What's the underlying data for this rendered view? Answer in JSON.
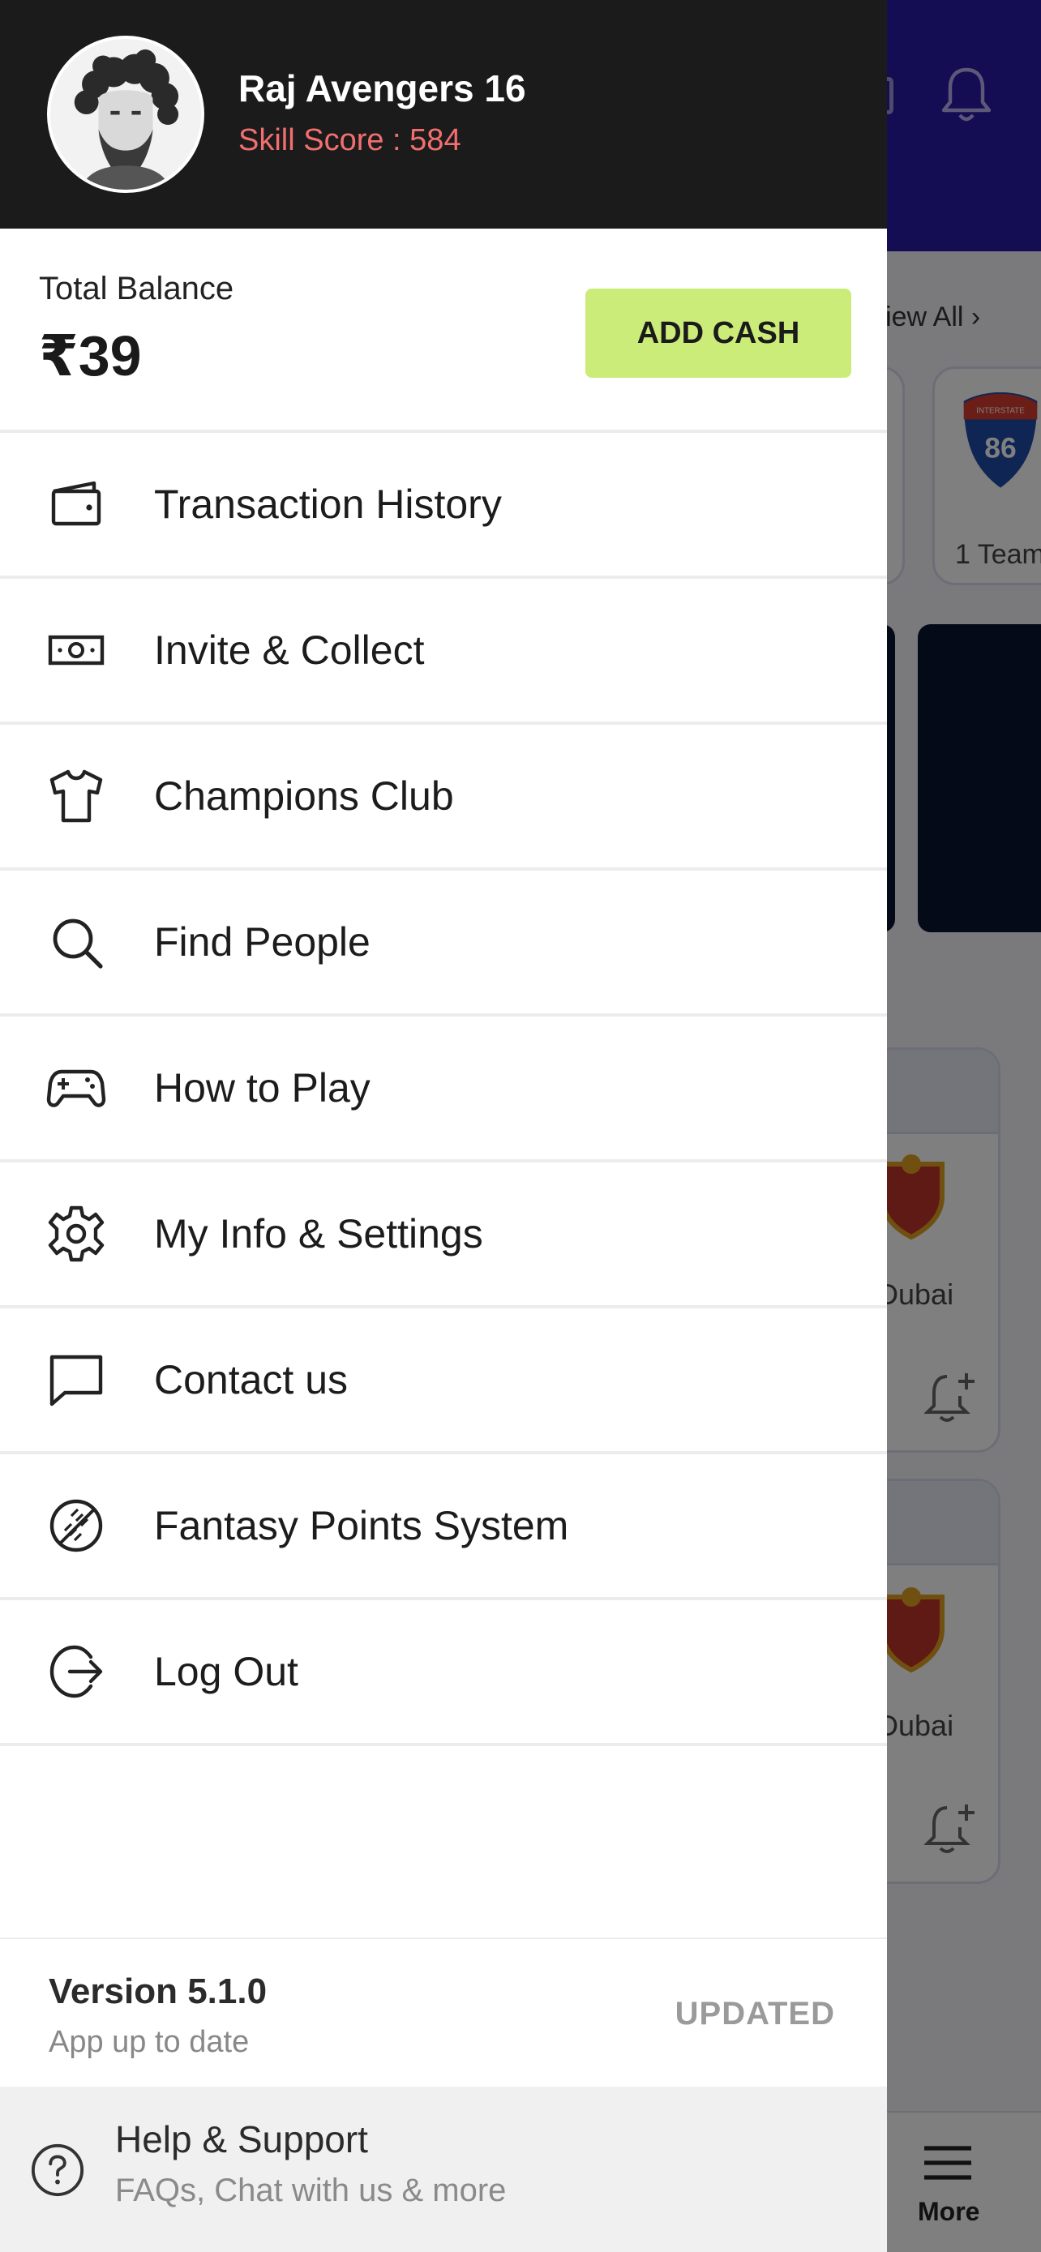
{
  "user": {
    "name": "Raj Avengers 16",
    "skill_score": "Skill Score : 584"
  },
  "balance": {
    "label": "Total Balance",
    "amount": "₹39",
    "add_cash_label": "ADD CASH"
  },
  "menu": {
    "items": [
      {
        "label": "Transaction History",
        "icon": "wallet-icon"
      },
      {
        "label": "Invite & Collect",
        "icon": "cash-note-icon"
      },
      {
        "label": "Champions Club",
        "icon": "jersey-icon"
      },
      {
        "label": "Find People",
        "icon": "search-icon"
      },
      {
        "label": "How to Play",
        "icon": "gamepad-icon"
      },
      {
        "label": "My Info & Settings",
        "icon": "gear-icon"
      },
      {
        "label": "Contact us",
        "icon": "chat-bubble-icon"
      },
      {
        "label": "Fantasy Points System",
        "icon": "cricket-ball-icon"
      },
      {
        "label": "Log Out",
        "icon": "logout-icon"
      }
    ]
  },
  "version": {
    "title": "Version 5.1.0",
    "subtitle": "App up to date",
    "status": "UPDATED"
  },
  "help": {
    "title": "Help & Support",
    "subtitle": "FAQs, Chat with us & more"
  },
  "background": {
    "view_all": "View All",
    "team_count": "1 Team",
    "shield_number": "86",
    "shield_banner": "INTERSTATE",
    "match_location_1": "Dubai",
    "match_location_2": "Dubai",
    "nav_more": "More"
  },
  "colors": {
    "drawer_header_bg": "#1b1b1b",
    "skill_score": "#f26f6f",
    "add_cash_bg": "#ccec7a",
    "app_header_bg": "#2a1aa8"
  }
}
